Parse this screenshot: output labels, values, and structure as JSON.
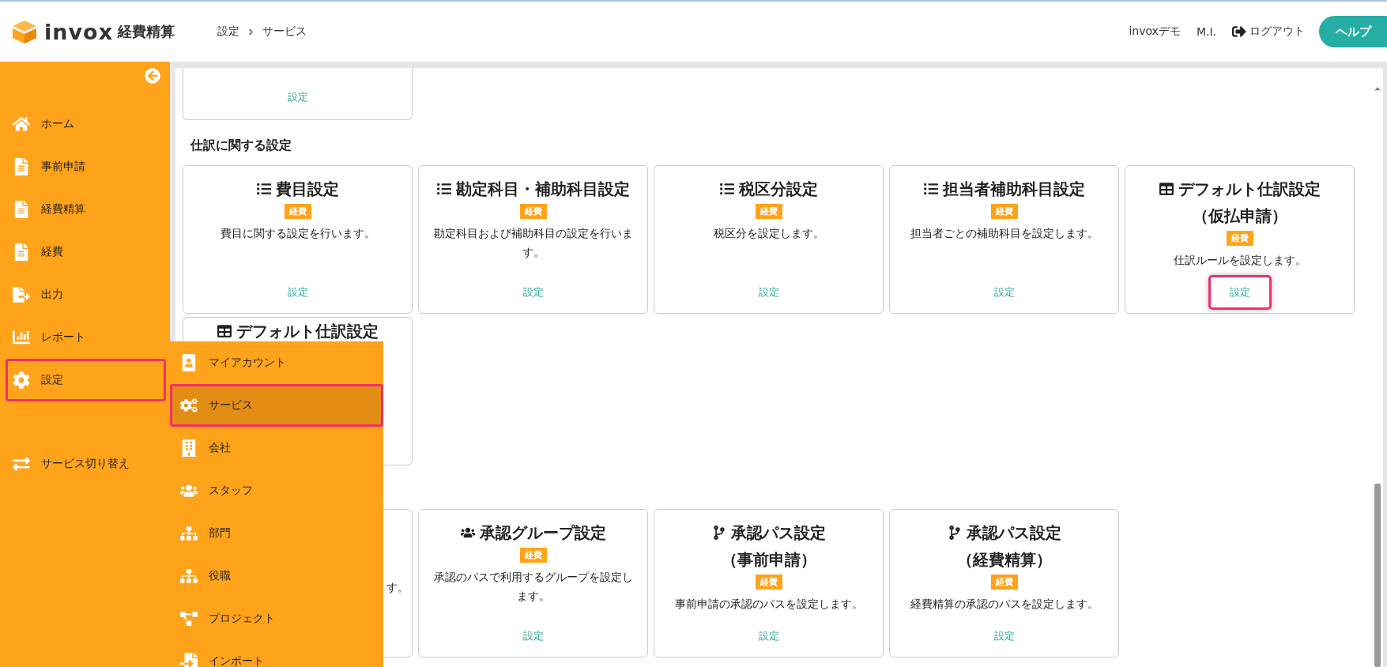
{
  "header": {
    "brand": "invox",
    "product": "経費精算",
    "breadcrumb": [
      "設定",
      "サービス"
    ],
    "tenant": "invoxデモ",
    "user": "M.I.",
    "logout": "ログアウト",
    "help": "ヘルプ"
  },
  "sidebar": {
    "items": [
      {
        "label": "ホーム",
        "highlighted": false
      },
      {
        "label": "事前申請",
        "highlighted": false
      },
      {
        "label": "経費精算",
        "highlighted": false
      },
      {
        "label": "経費",
        "highlighted": false
      },
      {
        "label": "出力",
        "highlighted": false
      },
      {
        "label": "レポート",
        "highlighted": false
      },
      {
        "label": "設定",
        "highlighted": true
      }
    ],
    "service_switch": {
      "label": "サービス切り替え"
    }
  },
  "flyout_menu": {
    "items": [
      {
        "label": "マイアカウント",
        "selected": false
      },
      {
        "label": "サービス",
        "selected": true
      },
      {
        "label": "会社",
        "selected": false
      },
      {
        "label": "スタッフ",
        "selected": false
      },
      {
        "label": "部門",
        "selected": false
      },
      {
        "label": "役職",
        "selected": false
      },
      {
        "label": "プロジェクト",
        "selected": false
      },
      {
        "label": "インポート",
        "selected": false
      }
    ]
  },
  "content": {
    "top_card": {
      "link": "設定"
    },
    "sections": [
      {
        "heading": "仕訳に関する設定",
        "cards": [
          {
            "kind": "full",
            "title_lines": [
              "費目設定"
            ],
            "badge": "経費",
            "description": "費目に関する設定を行います。",
            "link": "設定",
            "link_highlighted": false
          },
          {
            "kind": "full",
            "title_lines": [
              "勘定科目・補助科目設定"
            ],
            "badge": "経費",
            "description": "勘定科目および補助科目の設定を行います。",
            "link": "設定",
            "link_highlighted": false
          },
          {
            "kind": "full",
            "title_lines": [
              "税区分設定"
            ],
            "badge": "経費",
            "description": "税区分を設定します。",
            "link": "設定",
            "link_highlighted": false
          },
          {
            "kind": "full",
            "title_lines": [
              "担当者補助科目設定"
            ],
            "badge": "経費",
            "description": "担当者ごとの補助科目を設定します。",
            "link": "設定",
            "link_highlighted": false
          },
          {
            "kind": "full",
            "title_lines": [
              "デフォルト仕訳設定",
              "（仮払申請）"
            ],
            "badge": "経費",
            "description": "仕訳ルールを設定します。",
            "link": "設定",
            "link_highlighted": true
          },
          {
            "kind": "title_only",
            "title_lines": [
              "デフォルト仕訳設定"
            ]
          }
        ]
      },
      {
        "cards": [
          {
            "kind": "fragment",
            "description": "す。"
          },
          {
            "kind": "full",
            "title_lines": [
              "承認グループ設定"
            ],
            "badge": "経費",
            "description": "承認のパスで利用するグループを設定します。",
            "link": "設定",
            "link_highlighted": false
          },
          {
            "kind": "full",
            "title_lines": [
              "承認パス設定",
              "（事前申請）"
            ],
            "badge": "経費",
            "description": "事前申請の承認のパスを設定します。",
            "link": "設定",
            "link_highlighted": false
          },
          {
            "kind": "full",
            "title_lines": [
              "承認パス設定",
              "（経費精算）"
            ],
            "badge": "経費",
            "description": "経費精算の承認のパスを設定します。",
            "link": "設定",
            "link_highlighted": false
          }
        ]
      }
    ]
  }
}
